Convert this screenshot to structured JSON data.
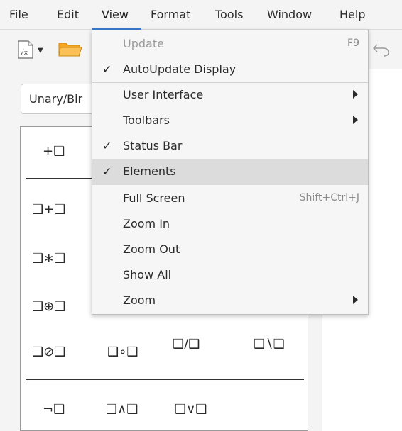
{
  "menubar": {
    "items": [
      "File",
      "Edit",
      "View",
      "Format",
      "Tools",
      "Window",
      "Help"
    ],
    "active": "View"
  },
  "toolbar": {
    "icons": [
      "formula-icon",
      "folder-open-icon",
      "undo-icon"
    ]
  },
  "elements": {
    "category": "Unary/Binary Operators",
    "category_visible": "Unary/Bir",
    "row1": [
      "+❑"
    ],
    "row2": [
      "❑+❑"
    ],
    "row3": [
      "❑∗❑"
    ],
    "row4": [
      "❑⊕❑"
    ],
    "row5": [
      "❑⊘❑",
      "❑∘❑",
      "❑/❑",
      "❑∖❑"
    ],
    "row6": [
      "¬❑",
      "❑∧❑",
      "❑∨❑"
    ]
  },
  "view_menu": {
    "items": [
      {
        "label": "Update",
        "shortcut": "F9",
        "checked": false,
        "disabled": true,
        "submenu": false
      },
      {
        "label": "AutoUpdate Display",
        "shortcut": "",
        "checked": true,
        "disabled": false,
        "submenu": false
      },
      {
        "label": "User Interface",
        "shortcut": "",
        "checked": false,
        "disabled": false,
        "submenu": true
      },
      {
        "label": "Toolbars",
        "shortcut": "",
        "checked": false,
        "disabled": false,
        "submenu": true
      },
      {
        "label": "Status Bar",
        "shortcut": "",
        "checked": true,
        "disabled": false,
        "submenu": false
      },
      {
        "label": "Elements",
        "shortcut": "",
        "checked": true,
        "disabled": false,
        "submenu": false,
        "highlighted": true
      },
      {
        "label": "Full Screen",
        "shortcut": "Shift+Ctrl+J",
        "checked": false,
        "disabled": false,
        "submenu": false
      },
      {
        "label": "Zoom In",
        "shortcut": "",
        "checked": false,
        "disabled": false,
        "submenu": false
      },
      {
        "label": "Zoom Out",
        "shortcut": "",
        "checked": false,
        "disabled": false,
        "submenu": false
      },
      {
        "label": "Show All",
        "shortcut": "",
        "checked": false,
        "disabled": false,
        "submenu": false
      },
      {
        "label": "Zoom",
        "shortcut": "",
        "checked": false,
        "disabled": false,
        "submenu": true
      }
    ],
    "checkmark": "✓"
  },
  "colors": {
    "accent": "#3b7bd1",
    "menu_bg": "#f6f6f6",
    "highlight": "#dcdcdc",
    "disabled_text": "#9a9a9a"
  }
}
